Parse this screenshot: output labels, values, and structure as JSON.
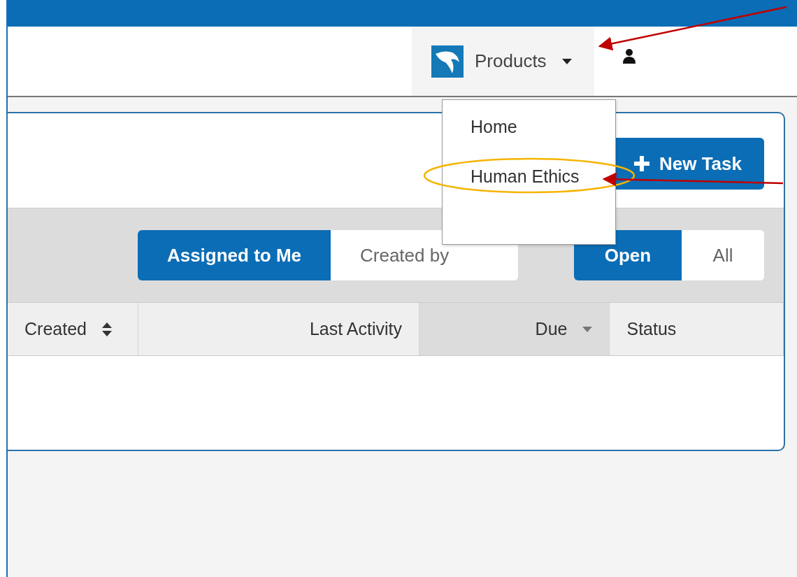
{
  "header": {
    "products_menu": {
      "label": "Products",
      "expanded": true
    },
    "menu_items": [
      {
        "label": "Home"
      },
      {
        "label": "Human Ethics"
      }
    ]
  },
  "toolbar": {
    "new_task": "New Task"
  },
  "assignment_filter": [
    {
      "label": "Assigned to Me",
      "selected": true
    },
    {
      "label": "Created by",
      "selected": false
    }
  ],
  "status_filter": [
    {
      "label": "Open",
      "selected": true
    },
    {
      "label": "All",
      "selected": false
    }
  ],
  "table": {
    "columns": [
      {
        "label": "Created",
        "kind": "sortable",
        "sorted": false
      },
      {
        "label": "Last Activity",
        "kind": "plain",
        "sorted": false
      },
      {
        "label": "Due",
        "kind": "sortdesc",
        "sorted": true
      },
      {
        "label": "Status",
        "kind": "plain",
        "sorted": false
      }
    ]
  },
  "annotations": {
    "highlight": true
  }
}
